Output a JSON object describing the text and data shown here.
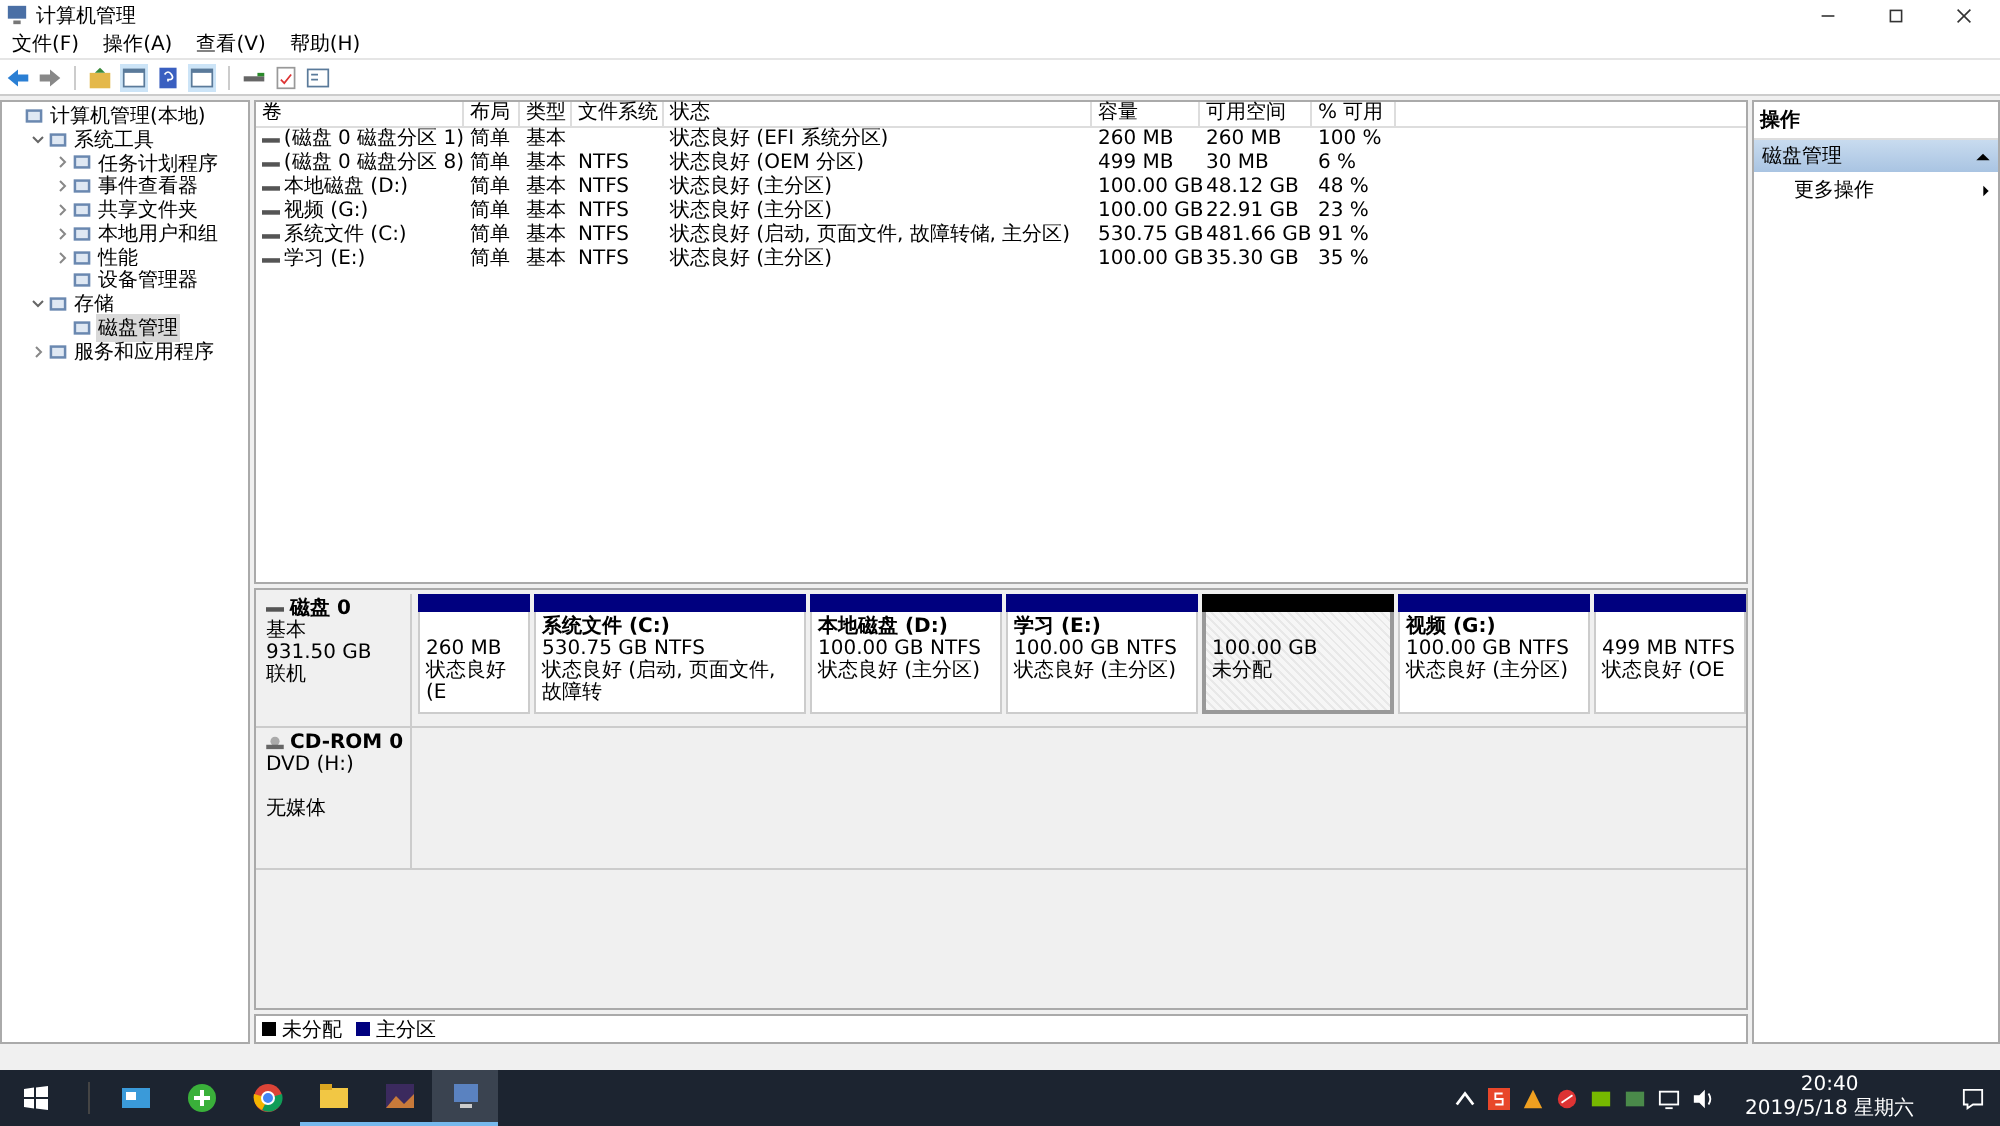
{
  "window": {
    "title": "计算机管理"
  },
  "menu": [
    "文件(F)",
    "操作(A)",
    "查看(V)",
    "帮助(H)"
  ],
  "tree": [
    {
      "label": "计算机管理(本地)",
      "selected": false,
      "children": [
        {
          "label": "系统工具",
          "expanded": true,
          "selected": false,
          "children": [
            {
              "label": "任务计划程序",
              "expanded": false,
              "selected": false
            },
            {
              "label": "事件查看器",
              "expanded": false,
              "selected": false
            },
            {
              "label": "共享文件夹",
              "expanded": false,
              "selected": false
            },
            {
              "label": "本地用户和组",
              "expanded": false,
              "selected": false
            },
            {
              "label": "性能",
              "expanded": false,
              "selected": false
            },
            {
              "label": "设备管理器",
              "selected": false
            }
          ]
        },
        {
          "label": "存储",
          "expanded": true,
          "selected": false,
          "children": [
            {
              "label": "磁盘管理",
              "selected": true
            }
          ]
        },
        {
          "label": "服务和应用程序",
          "expanded": false,
          "selected": false
        }
      ]
    }
  ],
  "table": {
    "columns": [
      "卷",
      "布局",
      "类型",
      "文件系统",
      "状态",
      "容量",
      "可用空间",
      "% 可用"
    ],
    "rows": [
      [
        "(磁盘 0 磁盘分区 1)",
        "简单",
        "基本",
        "",
        "状态良好 (EFI 系统分区)",
        "260 MB",
        "260 MB",
        "100 %"
      ],
      [
        "(磁盘 0 磁盘分区 8)",
        "简单",
        "基本",
        "NTFS",
        "状态良好 (OEM 分区)",
        "499 MB",
        "30 MB",
        "6 %"
      ],
      [
        "本地磁盘 (D:)",
        "简单",
        "基本",
        "NTFS",
        "状态良好 (主分区)",
        "100.00 GB",
        "48.12 GB",
        "48 %"
      ],
      [
        "视频 (G:)",
        "简单",
        "基本",
        "NTFS",
        "状态良好 (主分区)",
        "100.00 GB",
        "22.91 GB",
        "23 %"
      ],
      [
        "系统文件 (C:)",
        "简单",
        "基本",
        "NTFS",
        "状态良好 (启动, 页面文件, 故障转储, 主分区)",
        "530.75 GB",
        "481.66 GB",
        "91 %"
      ],
      [
        "学习 (E:)",
        "简单",
        "基本",
        "NTFS",
        "状态良好 (主分区)",
        "100.00 GB",
        "35.30 GB",
        "35 %"
      ]
    ]
  },
  "disks": [
    {
      "name": "磁盘 0",
      "kind": "disk",
      "lines": [
        "基本",
        "931.50 GB",
        "联机"
      ],
      "partitions": [
        {
          "kind": "primary",
          "size": "260 MB",
          "status": "状态良好 (E"
        },
        {
          "kind": "primary",
          "name": "系统文件  (C:)",
          "size": "530.75 GB NTFS",
          "status": "状态良好 (启动, 页面文件, 故障转"
        },
        {
          "kind": "primary",
          "name": "本地磁盘  (D:)",
          "size": "100.00 GB NTFS",
          "status": "状态良好 (主分区)"
        },
        {
          "kind": "primary",
          "name": "学习  (E:)",
          "size": "100.00 GB NTFS",
          "status": "状态良好 (主分区)"
        },
        {
          "kind": "unallocated",
          "size": "100.00 GB",
          "status": "未分配"
        },
        {
          "kind": "primary",
          "name": "视频  (G:)",
          "size": "100.00 GB NTFS",
          "status": "状态良好 (主分区)"
        },
        {
          "kind": "primary",
          "size": "499 MB NTFS",
          "status": "状态良好 (OE"
        }
      ]
    },
    {
      "name": "CD-ROM 0",
      "kind": "cdrom",
      "lines": [
        "DVD (H:)",
        "无媒体"
      ]
    }
  ],
  "legend": [
    {
      "kind": "unallocated",
      "label": "未分配",
      "color": "#000000"
    },
    {
      "kind": "primary",
      "label": "主分区",
      "color": "#00007f"
    }
  ],
  "actions": {
    "title": "操作",
    "section": "磁盘管理",
    "expanded": true,
    "items": [
      "更多操作"
    ]
  },
  "taskbar": {
    "apps": [
      {
        "selected": false,
        "running": false
      },
      {
        "selected": false,
        "running": false
      },
      {
        "selected": false,
        "running": false
      },
      {
        "selected": false,
        "running": true
      },
      {
        "selected": false,
        "running": true
      },
      {
        "selected": true,
        "running": true
      }
    ],
    "time": "20:40",
    "date": "2019/5/18 星期六"
  }
}
